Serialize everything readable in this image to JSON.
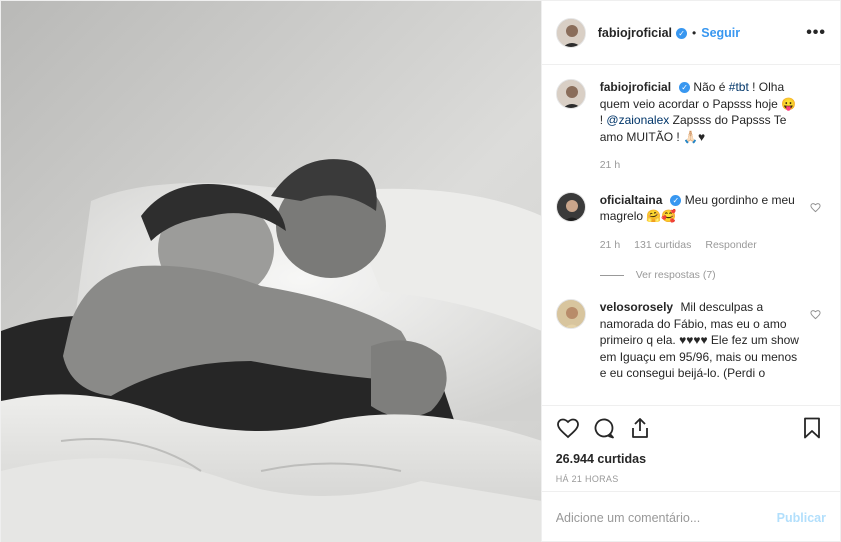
{
  "post": {
    "author": "fabiojroficial",
    "follow_label": "Seguir",
    "more_label": "•••",
    "dot": "•",
    "verified_mark": "✓"
  },
  "caption": {
    "username": "fabiojroficial",
    "text_1": "Não é ",
    "hashtag": "#tbt",
    "text_2": " ! Olha quem veio acordar o Papsss hoje 😛 ! ",
    "mention": "@zaionalex",
    "text_3": " Zapsss do Papsss Te amo MUITÃO ! 🙏🏻♥",
    "time": "21 h"
  },
  "comments": [
    {
      "username": "oficialtaina",
      "verified": true,
      "text": "Meu gordinho e meu magrelo 🤗🥰",
      "time": "21 h",
      "likes": "131 curtidas",
      "reply_label": "Responder",
      "view_replies": "Ver respostas (7)"
    },
    {
      "username": "velosorosely",
      "verified": false,
      "text": "Mil desculpas a namorada do Fábio, mas eu o amo primeiro q ela. ♥♥♥♥ Ele fez um show em Iguaçu em 95/96, mais ou menos e eu consegui beijá-lo. (Perdi o"
    }
  ],
  "footer": {
    "likes_count": "26.944 curtidas",
    "time_ago": "HÁ 21 HORAS",
    "comment_placeholder": "Adicione um comentário...",
    "publish_label": "Publicar"
  },
  "icons": {
    "like": "heart-icon",
    "comment": "comment-icon",
    "share": "share-icon",
    "save": "bookmark-icon",
    "comment_like": "heart-outline-icon"
  },
  "colors": {
    "accent": "#3897f0",
    "publish_disabled": "#b2dffc",
    "muted": "#999999",
    "text": "#262626"
  }
}
